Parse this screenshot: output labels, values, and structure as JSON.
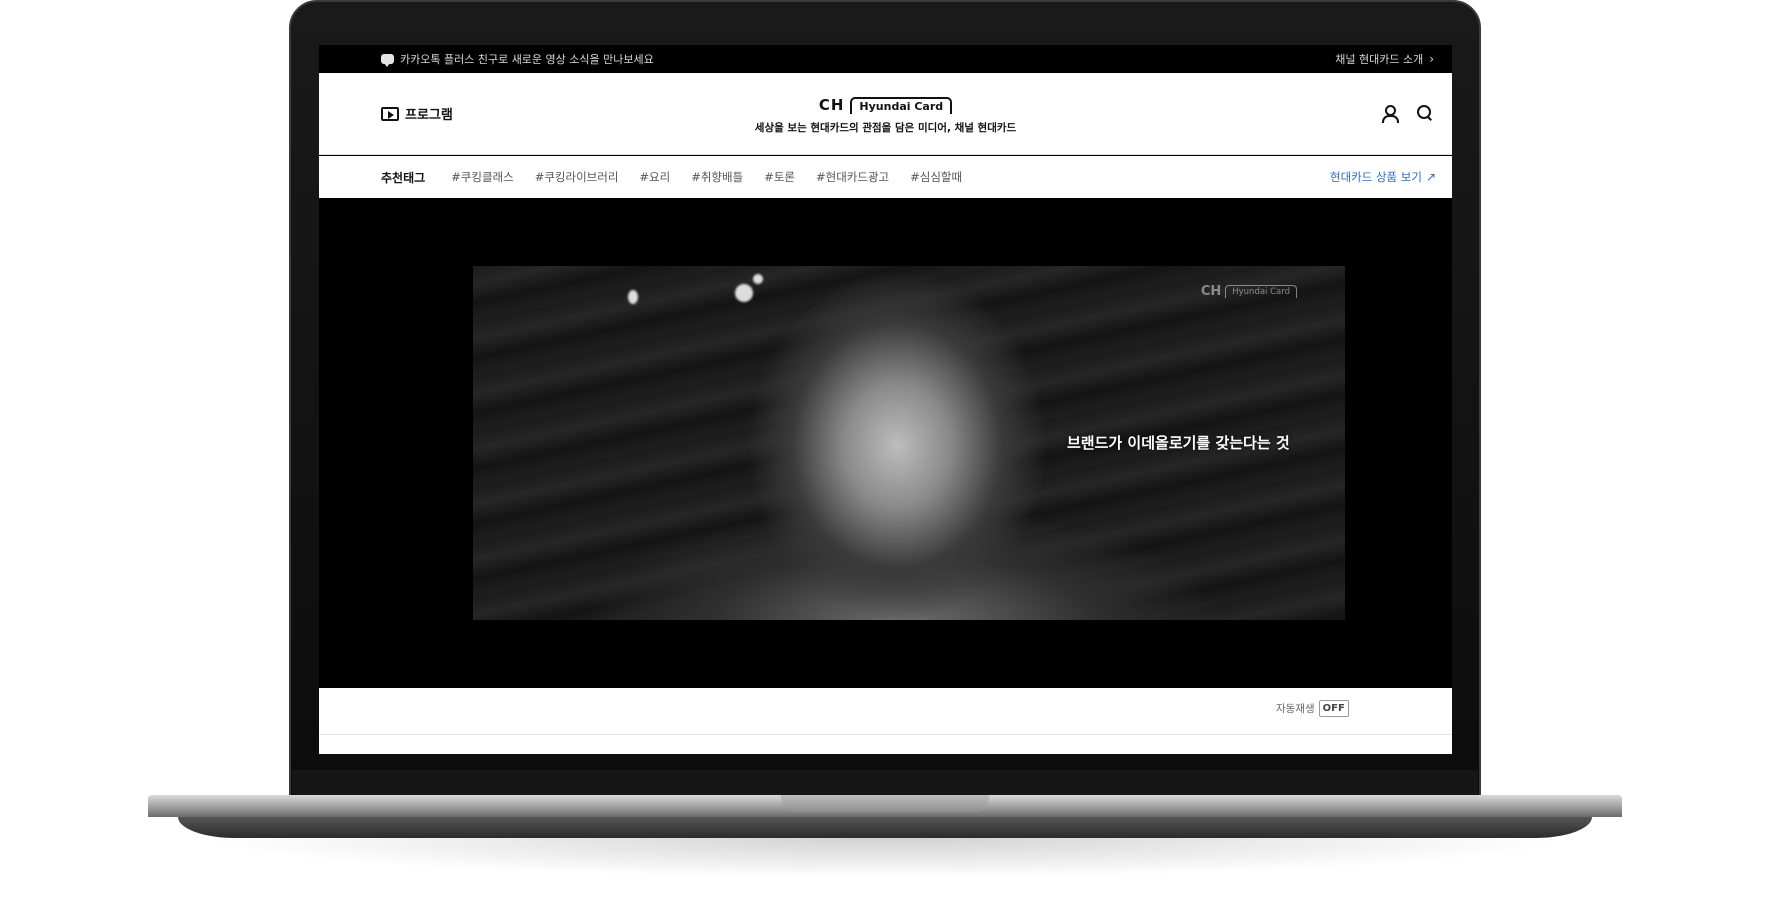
{
  "notice": {
    "text": "카카오톡 플러스 친구로 새로운 영상 소식을 만나보세요",
    "right_link": "채널 현대카드 소개"
  },
  "header": {
    "program_label": "프로그램",
    "logo_ch": "CH",
    "logo_brand": "Hyundai Card",
    "tagline": "세상을 보는 현대카드의 관점을 담은 미디어, 채널 현대카드"
  },
  "tag_nav": {
    "title": "추천태그",
    "tags": [
      "#쿠킹클래스",
      "#쿠킹라이브러리",
      "#요리",
      "#취향배틀",
      "#토론",
      "#현대카드광고",
      "#심심할때"
    ],
    "product_link": "현대카드 상품 보기"
  },
  "video": {
    "watermark_ch": "CH",
    "watermark_brand": "Hyundai Card",
    "caption": "브랜드가 이데올로기를 갖는다는 것"
  },
  "controls": {
    "autoplay_label": "자동재생",
    "autoplay_state": "OFF"
  },
  "colors": {
    "link_blue": "#2a6cc7",
    "background_black": "#000000"
  }
}
